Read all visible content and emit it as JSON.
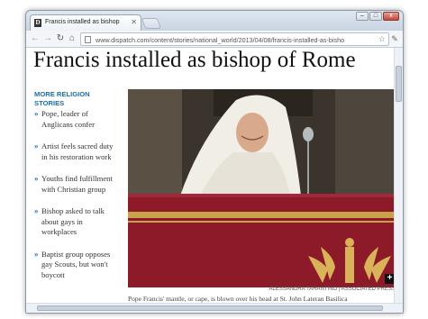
{
  "browser": {
    "tab_title": "Francis installed as bishop",
    "tab_favicon": "D",
    "url": "www.dispatch.com/content/stories/national_world/2013/04/08/francis-installed-as-bisho"
  },
  "article": {
    "headline": "Francis installed as bishop of Rome",
    "sidebar_heading": "MORE RELIGION STORIES",
    "related_stories": [
      "Pope, leader of Anglicans confer",
      "Artist feels sacred duty in his restoration work",
      "Youths find fulfillment with Christian group",
      "Bishop asked to talk about gays in workplaces",
      "Baptist group opposes gay Scouts, but won't boycott"
    ],
    "photo_credit": "ALESSANDRA TARANTINO | ASSOCIATED PRESS",
    "caption": "Pope Francis' mantle, or cape, is blown over his head at St. John Lateran Basilica"
  },
  "icons": {
    "back": "back-arrow-icon",
    "forward": "forward-arrow-icon",
    "reload": "reload-icon",
    "home": "home-icon",
    "bookmark": "star-icon",
    "menu": "wrench-icon",
    "expand": "expand-plus-icon",
    "bullet": "chevron-right-icon"
  },
  "colors": {
    "accent": "#1d6ea3",
    "drape": "#8c1a28",
    "gold": "#c9a24a"
  }
}
